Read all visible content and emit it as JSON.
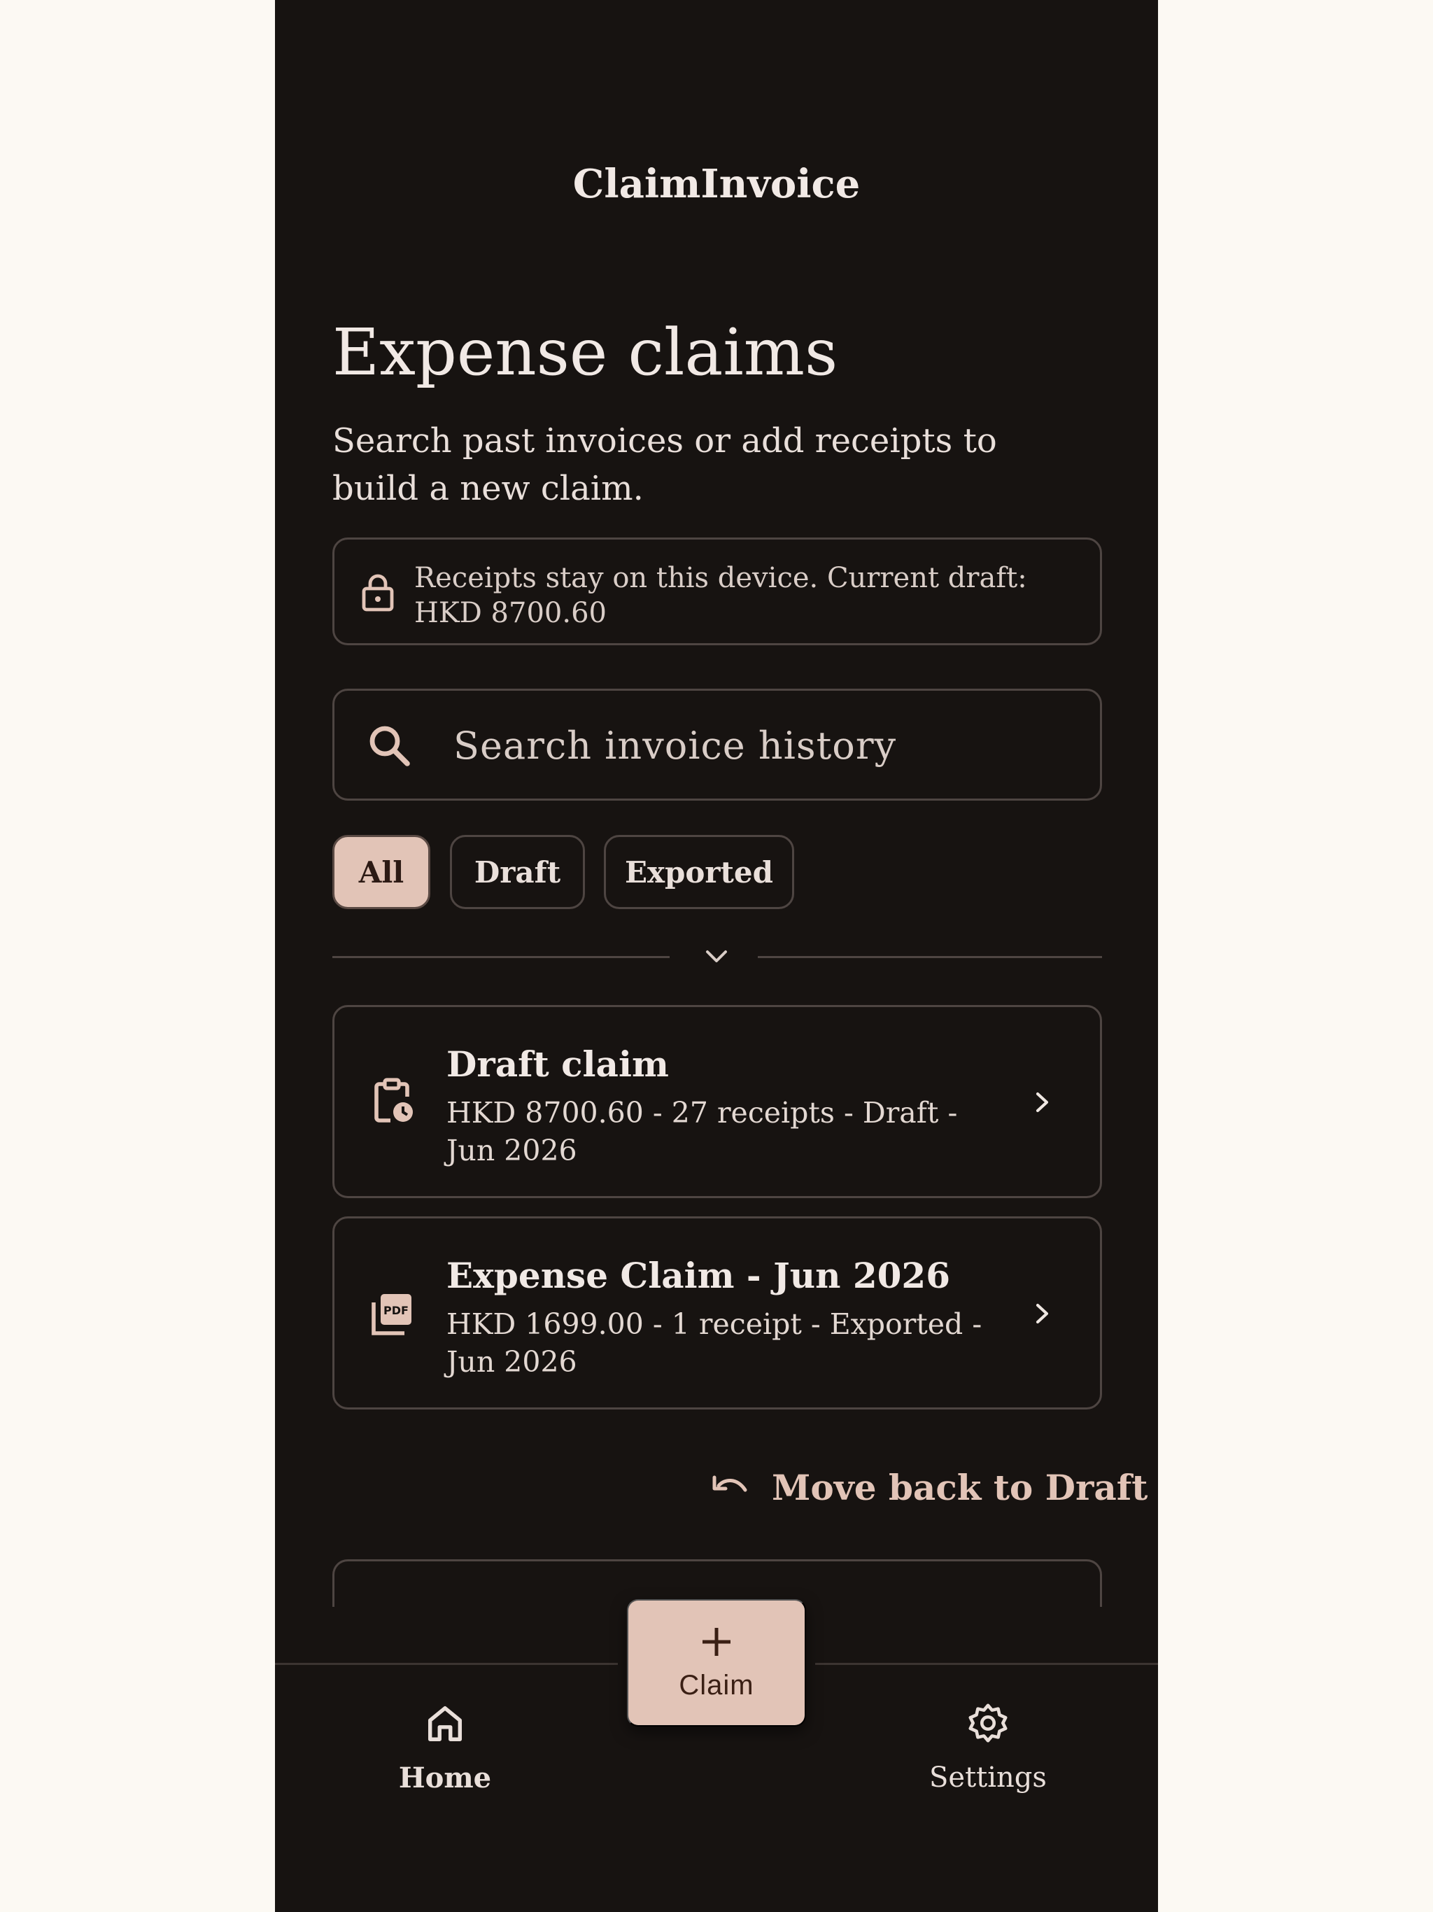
{
  "app": {
    "title": "ClaimInvoice"
  },
  "header": {
    "title": "Expense claims",
    "subtitle": "Search past invoices or add receipts to build a new claim."
  },
  "notice": {
    "text": "Receipts stay on this device. Current draft: HKD 8700.60",
    "icon": "lock-icon"
  },
  "search": {
    "placeholder": "Search invoice history",
    "value": "",
    "icon": "search-icon"
  },
  "filters": [
    {
      "label": "All",
      "selected": true
    },
    {
      "label": "Draft",
      "selected": false
    },
    {
      "label": "Exported",
      "selected": false
    }
  ],
  "claims": [
    {
      "title": "Draft claim",
      "subtitle": "HKD 8700.60 - 27 receipts - Draft - Jun 2026",
      "icon": "clipboard-clock-icon"
    },
    {
      "title": "Expense Claim - Jun 2026",
      "subtitle": "HKD 1699.00 - 1 receipt - Exported - Jun 2026",
      "icon": "pdf-icon"
    }
  ],
  "actions": {
    "move_back_label": "Move back to Draft"
  },
  "fab": {
    "label": "Claim",
    "icon": "plus-icon"
  },
  "nav": {
    "home_label": "Home",
    "settings_label": "Settings"
  },
  "colors": {
    "background": "#171311",
    "outer_background": "#fcf9f3",
    "accent": "#e2c4b7",
    "border": "#4e4542",
    "text": "#efe7e2"
  }
}
